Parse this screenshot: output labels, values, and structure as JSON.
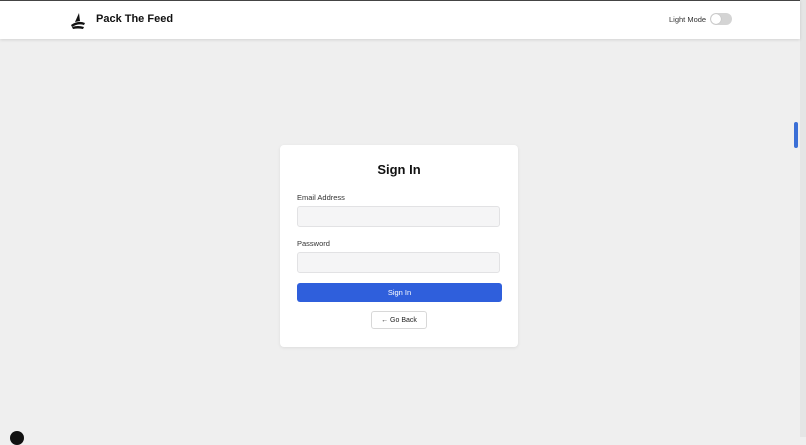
{
  "header": {
    "brand": "Pack The Feed",
    "mode_label": "Light Mode",
    "logo_icon": "brand-logo-icon",
    "toggle_icon": "toggle-switch-icon"
  },
  "signin": {
    "title": "Sign In",
    "email_label": "Email Address",
    "email_value": "",
    "password_label": "Password",
    "password_value": "",
    "submit_label": "Sign In",
    "back_label": "← Go Back"
  },
  "colors": {
    "accent": "#2f5fdc",
    "background": "#efefef",
    "card": "#ffffff"
  }
}
